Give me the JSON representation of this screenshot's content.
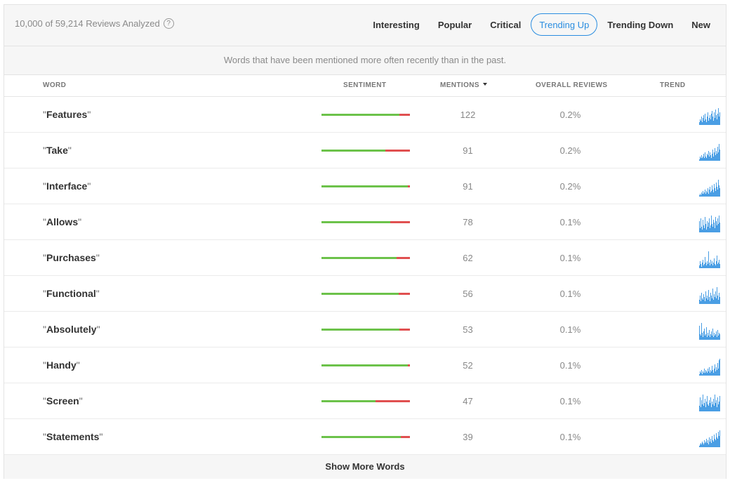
{
  "header": {
    "analyzed_label": "10,000 of 59,214 Reviews Analyzed",
    "help_glyph": "?"
  },
  "tabs": [
    {
      "label": "Interesting",
      "active": false
    },
    {
      "label": "Popular",
      "active": false
    },
    {
      "label": "Critical",
      "active": false
    },
    {
      "label": "Trending Up",
      "active": true
    },
    {
      "label": "Trending Down",
      "active": false
    },
    {
      "label": "New",
      "active": false
    }
  ],
  "description": "Words that have been mentioned more often recently than in the past.",
  "columns": {
    "word": "WORD",
    "sentiment": "SENTIMENT",
    "mentions": "MENTIONS",
    "overall": "OVERALL REVIEWS",
    "trend": "TREND"
  },
  "colors": {
    "accent": "#2a8de0",
    "positive": "#6cc24a",
    "negative": "#e05050",
    "trend": "#2a8de0"
  },
  "rows": [
    {
      "word": "Features",
      "positive": 0.88,
      "mentions": "122",
      "overall": "0.2%",
      "trend": [
        2,
        4,
        3,
        6,
        2,
        5,
        7,
        3,
        8,
        4,
        2,
        6,
        9,
        3,
        5,
        7,
        4,
        8,
        10,
        6,
        3,
        9,
        5,
        11,
        7,
        4,
        8,
        12,
        6,
        9
      ]
    },
    {
      "word": "Take",
      "positive": 0.72,
      "mentions": "91",
      "overall": "0.2%",
      "trend": [
        1,
        3,
        2,
        4,
        2,
        3,
        5,
        2,
        6,
        3,
        2,
        5,
        4,
        7,
        3,
        6,
        4,
        2,
        5,
        8,
        3,
        6,
        9,
        4,
        7,
        5,
        10,
        6,
        12,
        8
      ]
    },
    {
      "word": "Interface",
      "positive": 0.98,
      "mentions": "91",
      "overall": "0.2%",
      "trend": [
        1,
        2,
        1,
        3,
        2,
        4,
        2,
        3,
        5,
        2,
        4,
        3,
        6,
        2,
        5,
        7,
        3,
        4,
        8,
        5,
        3,
        9,
        6,
        4,
        10,
        7,
        5,
        12,
        8,
        6
      ]
    },
    {
      "word": "Allows",
      "positive": 0.78,
      "mentions": "78",
      "overall": "0.1%",
      "trend": [
        8,
        3,
        10,
        4,
        2,
        9,
        5,
        3,
        11,
        6,
        2,
        8,
        4,
        7,
        10,
        3,
        5,
        12,
        6,
        4,
        9,
        7,
        3,
        11,
        8,
        5,
        10,
        6,
        12,
        7
      ]
    },
    {
      "word": "Purchases",
      "positive": 0.85,
      "mentions": "62",
      "overall": "0.1%",
      "trend": [
        2,
        5,
        3,
        1,
        4,
        6,
        2,
        3,
        8,
        4,
        2,
        5,
        3,
        12,
        4,
        2,
        6,
        3,
        5,
        2,
        4,
        7,
        3,
        2,
        5,
        9,
        3,
        4,
        6,
        3
      ]
    },
    {
      "word": "Functional",
      "positive": 0.87,
      "mentions": "56",
      "overall": "0.1%",
      "trend": [
        3,
        6,
        2,
        8,
        4,
        3,
        7,
        5,
        2,
        9,
        4,
        6,
        3,
        10,
        5,
        2,
        8,
        6,
        4,
        11,
        3,
        7,
        5,
        9,
        4,
        12,
        6,
        3,
        8,
        5
      ]
    },
    {
      "word": "Absolutely",
      "positive": 0.88,
      "mentions": "53",
      "overall": "0.1%",
      "trend": [
        10,
        4,
        3,
        12,
        5,
        2,
        6,
        8,
        3,
        4,
        9,
        2,
        5,
        3,
        7,
        2,
        4,
        6,
        3,
        8,
        2,
        5,
        3,
        4,
        6,
        2,
        7,
        3,
        5,
        4
      ]
    },
    {
      "word": "Handy",
      "positive": 0.98,
      "mentions": "52",
      "overall": "0.1%",
      "trend": [
        1,
        3,
        2,
        4,
        1,
        3,
        2,
        5,
        2,
        4,
        3,
        2,
        5,
        3,
        6,
        2,
        4,
        3,
        7,
        4,
        2,
        5,
        8,
        3,
        6,
        4,
        9,
        5,
        11,
        12
      ]
    },
    {
      "word": "Screen",
      "positive": 0.61,
      "mentions": "47",
      "overall": "0.1%",
      "trend": [
        4,
        10,
        3,
        8,
        5,
        12,
        4,
        6,
        9,
        3,
        7,
        11,
        5,
        4,
        8,
        6,
        10,
        3,
        7,
        5,
        9,
        4,
        12,
        6,
        8,
        3,
        10,
        5,
        7,
        11
      ]
    },
    {
      "word": "Statements",
      "positive": 0.9,
      "mentions": "39",
      "overall": "0.1%",
      "trend": [
        1,
        2,
        3,
        2,
        4,
        3,
        2,
        5,
        3,
        4,
        6,
        3,
        5,
        2,
        7,
        4,
        6,
        3,
        8,
        5,
        4,
        9,
        6,
        5,
        10,
        7,
        6,
        11,
        8,
        12
      ]
    }
  ],
  "footer": {
    "show_more": "Show More Words"
  }
}
